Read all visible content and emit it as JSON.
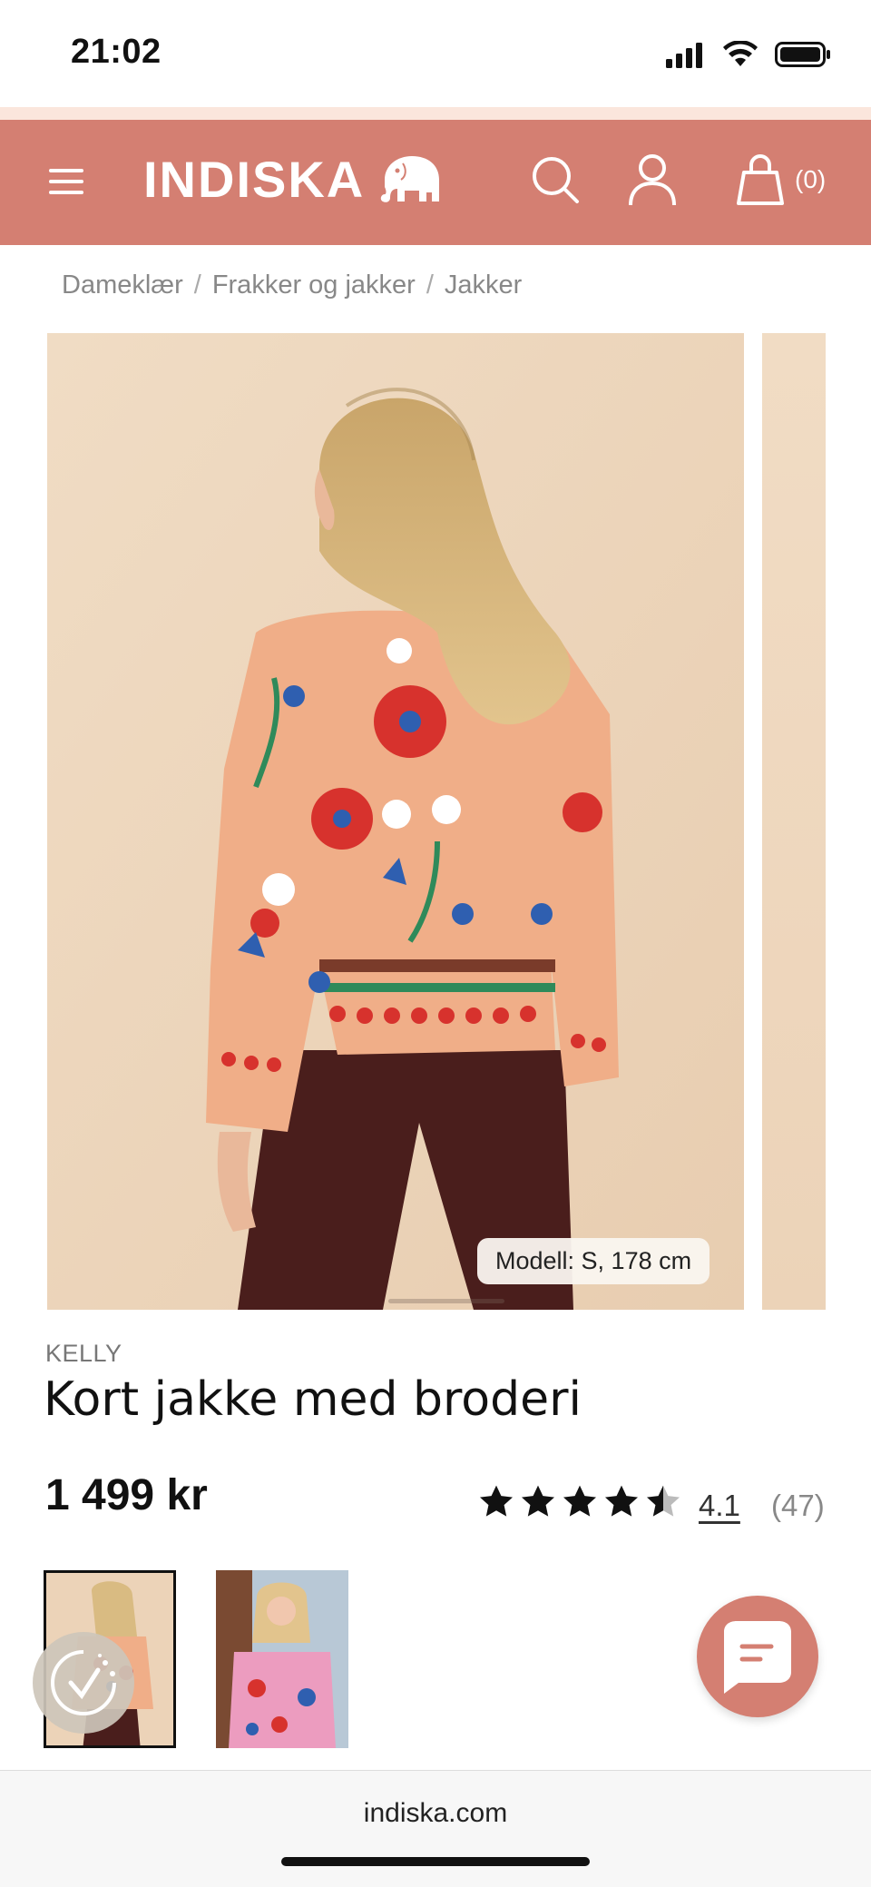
{
  "status_bar": {
    "time": "21:02"
  },
  "header": {
    "logo_text": "INDISKA",
    "bag_count": "(0)",
    "accent_color": "#d47f72"
  },
  "breadcrumb": {
    "items": [
      "Dameklær",
      "Frakker og jakker",
      "Jakker"
    ],
    "separator": "/"
  },
  "gallery": {
    "model_info": "Modell: S, 178 cm"
  },
  "product": {
    "brand": "KELLY",
    "title": "Kort jakke med broderi",
    "price": "1 499 kr",
    "rating_value": "4.1",
    "rating_count": "(47)",
    "rating_stars": 4.1
  },
  "bottom_bar": {
    "url": "indiska.com"
  },
  "icons": {
    "menu": "menu-icon",
    "search": "search-icon",
    "account": "user-icon",
    "bag": "shopping-bag-icon",
    "chat": "chat-icon",
    "cookie": "cookie-consent-icon"
  }
}
